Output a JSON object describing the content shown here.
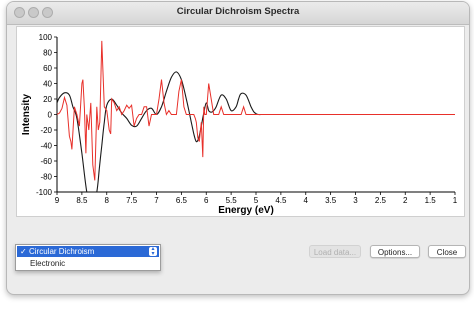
{
  "window": {
    "title": "Circular Dichroism Spectra"
  },
  "spectrum_dropdown": {
    "options": [
      "Circular Dichroism",
      "Electronic"
    ],
    "selected": "Circular Dichroism",
    "check_mark": "✓"
  },
  "buttons": {
    "load_data": "Load data...",
    "options": "Options...",
    "close": "Close"
  },
  "chart_data": {
    "type": "line",
    "xlabel": "Energy (eV)",
    "ylabel": "Intensity",
    "xlim": [
      9,
      1
    ],
    "ylim": [
      -100,
      100
    ],
    "x_ticks": [
      "9",
      "8.5",
      "8",
      "7.5",
      "7",
      "6.5",
      "6",
      "5.5",
      "5",
      "4.5",
      "4",
      "3.5",
      "3",
      "2.5",
      "2",
      "1.5",
      "1"
    ],
    "y_ticks": [
      "100",
      "80",
      "60",
      "40",
      "20",
      "0",
      "-20",
      "-40",
      "-60",
      "-80",
      "-100"
    ],
    "grid": false,
    "colors": {
      "broadened": "#1a1a1a",
      "sticks": "#e8302a"
    },
    "series": [
      {
        "style": "smooth",
        "color": "#1a1a1a",
        "x": [
          9.0,
          8.95,
          8.85,
          8.75,
          8.68,
          8.6,
          8.5,
          8.4,
          8.3,
          8.2,
          8.15,
          8.1,
          8.05,
          8.0,
          7.9,
          7.8,
          7.7,
          7.6,
          7.5,
          7.4,
          7.3,
          7.2,
          7.1,
          7.0,
          6.9,
          6.8,
          6.7,
          6.6,
          6.5,
          6.4,
          6.3,
          6.25,
          6.2,
          6.15,
          6.1,
          6.05,
          6.0,
          5.95,
          5.9,
          5.85,
          5.8,
          5.7,
          5.6,
          5.5,
          5.4,
          5.35,
          5.3,
          5.2,
          5.1,
          5.05,
          5.0,
          4.95,
          4.9,
          4.8
        ],
        "y": [
          15,
          22,
          28,
          25,
          10,
          -5,
          -50,
          -100,
          -120,
          -100,
          -70,
          -40,
          -10,
          12,
          20,
          12,
          2,
          -5,
          -14,
          -15,
          -5,
          5,
          8,
          0,
          10,
          30,
          48,
          55,
          45,
          20,
          -10,
          -25,
          -35,
          -30,
          -15,
          2,
          15,
          5,
          3,
          5,
          10,
          25,
          20,
          5,
          10,
          20,
          27,
          25,
          10,
          4,
          1,
          0,
          0,
          0
        ]
      },
      {
        "style": "stick",
        "color": "#e8302a",
        "x": [
          9.0,
          8.95,
          8.9,
          8.85,
          8.8,
          8.75,
          8.72,
          8.7,
          8.65,
          8.6,
          8.55,
          8.5,
          8.48,
          8.45,
          8.42,
          8.4,
          8.36,
          8.32,
          8.28,
          8.24,
          8.2,
          8.17,
          8.14,
          8.1,
          8.05,
          8.0,
          7.95,
          7.92,
          7.9,
          7.85,
          7.8,
          7.75,
          7.7,
          7.65,
          7.6,
          7.55,
          7.5,
          7.45,
          7.4,
          7.35,
          7.3,
          7.25,
          7.2,
          7.15,
          7.1,
          7.05,
          7.0,
          6.95,
          6.9,
          6.85,
          6.8,
          6.75,
          6.7,
          6.65,
          6.6,
          6.55,
          6.5,
          6.45,
          6.4,
          6.35,
          6.3,
          6.25,
          6.22,
          6.2,
          6.17,
          6.14,
          6.1,
          6.07,
          6.05,
          6.03,
          6.0,
          5.95,
          5.9,
          5.85,
          5.8,
          5.75,
          5.7,
          5.65,
          5.6,
          5.55,
          5.5,
          5.45,
          5.4,
          5.35,
          5.3,
          5.25,
          5.2,
          5.15,
          5.1,
          5.0,
          4.5,
          4.0,
          3.5,
          3.0,
          2.5,
          2.0,
          1.5,
          1.0
        ],
        "y": [
          0,
          2,
          8,
          22,
          12,
          -28,
          -35,
          -45,
          10,
          0,
          -15,
          40,
          45,
          8,
          -50,
          0,
          -20,
          15,
          -65,
          -85,
          10,
          -20,
          -10,
          95,
          10,
          5,
          -20,
          -25,
          20,
          15,
          5,
          10,
          0,
          5,
          12,
          8,
          12,
          -15,
          -5,
          0,
          0,
          10,
          10,
          -15,
          0,
          0,
          0,
          20,
          45,
          15,
          0,
          5,
          0,
          0,
          0,
          30,
          45,
          10,
          0,
          0,
          0,
          0,
          -5,
          -10,
          -30,
          -35,
          -10,
          -55,
          10,
          0,
          0,
          40,
          20,
          0,
          0,
          0,
          10,
          0,
          0,
          0,
          0,
          0,
          0,
          0,
          0,
          10,
          0,
          0,
          0,
          0,
          0,
          0,
          0,
          0,
          0,
          0,
          0,
          0
        ]
      }
    ]
  }
}
